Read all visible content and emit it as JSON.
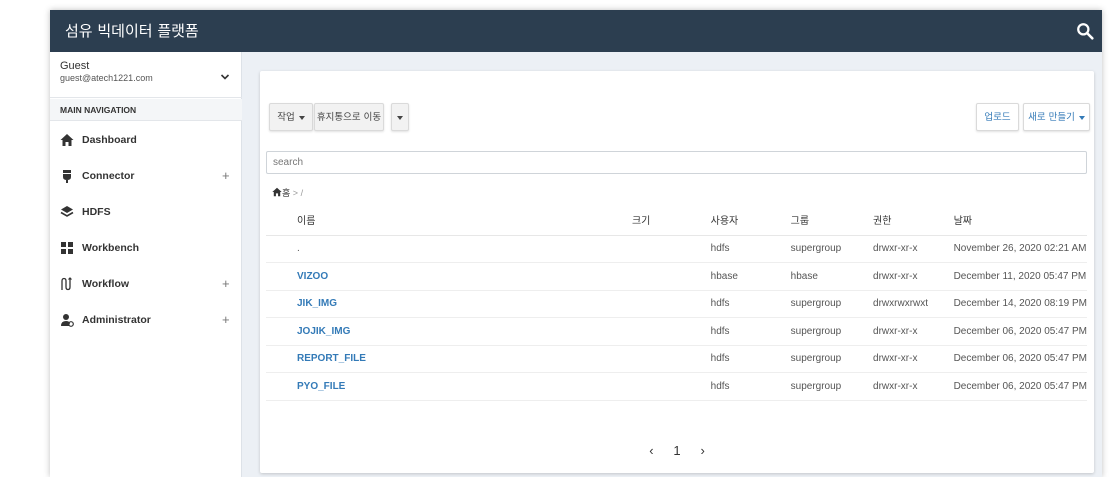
{
  "header": {
    "title": "섬유 빅데이터 플랫폼",
    "search_icon": "search-icon"
  },
  "user": {
    "name": "Guest",
    "email": "guest@atech1221.com"
  },
  "nav": {
    "heading": "MAIN NAVIGATION",
    "items": [
      {
        "label": "Dashboard",
        "icon": "home-icon",
        "plus": ""
      },
      {
        "label": "Connector",
        "icon": "plug-icon",
        "plus": "+"
      },
      {
        "label": "HDFS",
        "icon": "layers-icon",
        "plus": ""
      },
      {
        "label": "Workbench",
        "icon": "grid-icon",
        "plus": ""
      },
      {
        "label": "Workflow",
        "icon": "workflow-icon",
        "plus": "+"
      },
      {
        "label": "Administrator",
        "icon": "user-gear-icon",
        "plus": "+"
      }
    ]
  },
  "toolbar": {
    "action_label": "작업",
    "trash_label": "휴지통으로 이동",
    "upload_label": "업로드",
    "new_label": "새로 만들기"
  },
  "search": {
    "placeholder": "search"
  },
  "breadcrumb": {
    "home": "홈",
    "sep": ">",
    "path": "/"
  },
  "table": {
    "headers": [
      "이름",
      "크기",
      "사용자",
      "그룹",
      "권한",
      "날짜"
    ],
    "rows": [
      {
        "name": ".",
        "size": "",
        "user": "hdfs",
        "group": "supergroup",
        "perm": "drwxr-xr-x",
        "date": "November 26, 2020 02:21 AM"
      },
      {
        "name": "VIZOO",
        "size": "",
        "user": "hbase",
        "group": "hbase",
        "perm": "drwxr-xr-x",
        "date": "December 11, 2020 05:47 PM"
      },
      {
        "name": "JIK_IMG",
        "size": "",
        "user": "hdfs",
        "group": "supergroup",
        "perm": "drwxrwxrwxt",
        "date": "December 14, 2020 08:19 PM"
      },
      {
        "name": "JOJIK_IMG",
        "size": "",
        "user": "hdfs",
        "group": "supergroup",
        "perm": "drwxr-xr-x",
        "date": "December 06, 2020 05:47 PM"
      },
      {
        "name": "REPORT_FILE",
        "size": "",
        "user": "hdfs",
        "group": "supergroup",
        "perm": "drwxr-xr-x",
        "date": "December 06, 2020 05:47 PM"
      },
      {
        "name": "PYO_FILE",
        "size": "",
        "user": "hdfs",
        "group": "supergroup",
        "perm": "drwxr-xr-x",
        "date": "December 06, 2020 05:47 PM"
      }
    ]
  },
  "pagination": {
    "prev": "‹",
    "page": "1",
    "next": "›"
  },
  "colors": {
    "header_bg": "#2c3e50",
    "link": "#337ab7",
    "page_bg": "#ecf0f5"
  }
}
